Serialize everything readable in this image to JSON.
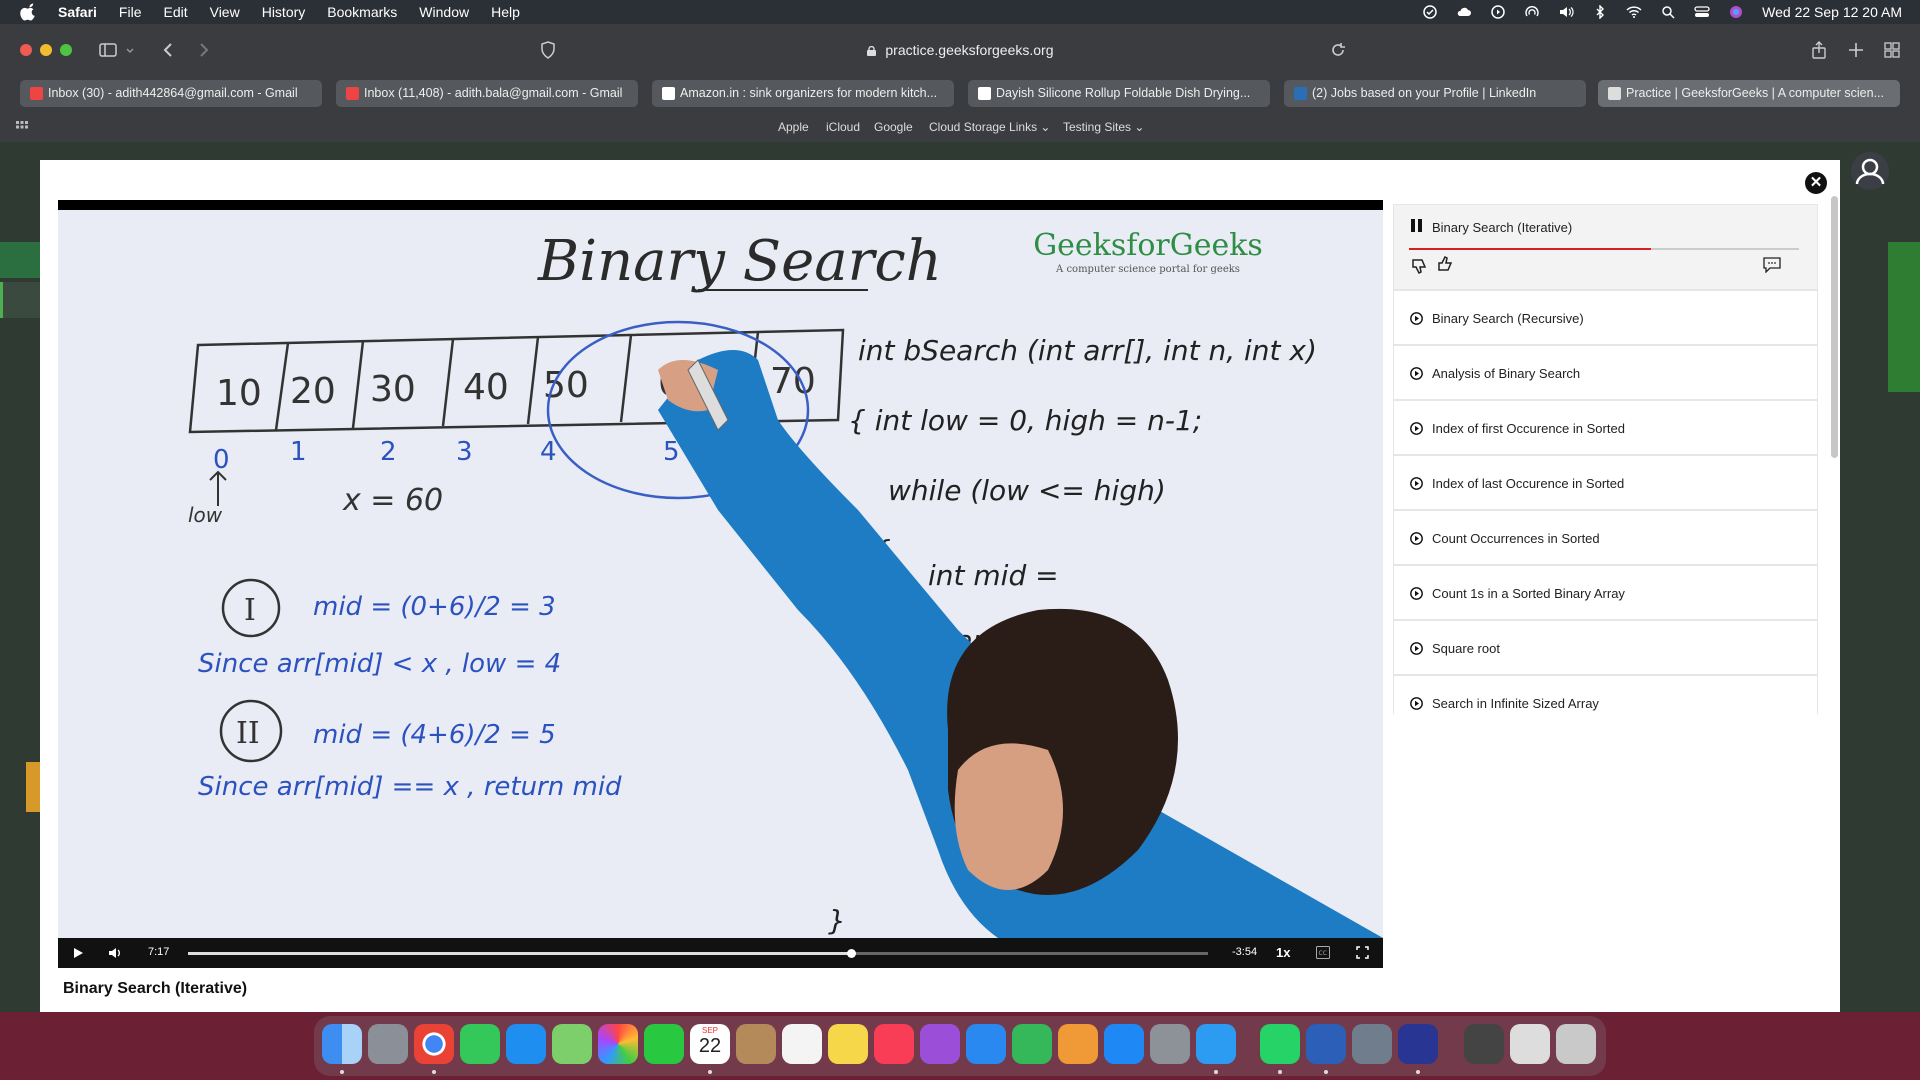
{
  "menubar": {
    "app_name": "Safari",
    "menus": [
      "File",
      "Edit",
      "View",
      "History",
      "Bookmarks",
      "Window",
      "Help"
    ],
    "clock": "Wed 22 Sep  12 20 AM"
  },
  "browser": {
    "url": "practice.geeksforgeeks.org",
    "tabs": [
      {
        "label": "Inbox (30) - adith442864@gmail.com - Gmail",
        "icon": "gmail-icon"
      },
      {
        "label": "Inbox (11,408) - adith.bala@gmail.com - Gmail",
        "icon": "gmail-icon"
      },
      {
        "label": "Amazon.in : sink organizers for modern kitch...",
        "icon": "amazon-icon"
      },
      {
        "label": "Dayish Silicone Rollup Foldable Dish Drying...",
        "icon": "amazon-icon"
      },
      {
        "label": "(2) Jobs based on your Profile | LinkedIn",
        "icon": "linkedin-icon"
      },
      {
        "label": "Practice | GeeksforGeeks | A computer scien...",
        "icon": "gfg-icon"
      }
    ],
    "favorites": [
      "Apple",
      "iCloud",
      "Google",
      "Cloud Storage Links",
      "Testing Sites"
    ]
  },
  "video": {
    "elapsed": "7:17",
    "remaining": "-3:54",
    "speed": "1x",
    "progress": 0.65,
    "watermark": "GeeksforGeeks",
    "watermark_tagline": "A computer science portal for geeks",
    "title": "Binary Search (Iterative)"
  },
  "whiteboard": {
    "heading": "Binary Search",
    "array": [
      "10",
      "20",
      "30",
      "40",
      "50",
      "60",
      "70"
    ],
    "indices": [
      "0",
      "1",
      "2",
      "3",
      "4",
      "5"
    ],
    "low_label": "low",
    "x_eq": "x = 60",
    "step1_num": "I",
    "step1_mid": "mid = (0+6)/2 = 3",
    "step1_since": "Since  arr[mid] < x ,  low = 4",
    "step2_num": "II",
    "step2_mid": "mid = (4+6)/2 = 5",
    "step2_since": "Since  arr[mid] == x ,  return mid",
    "code1": "int bSearch (int arr[], int n, int x)",
    "code2": "{   int low = 0,  high = n-1;",
    "code3": "while (low <= high)",
    "code4": "{",
    "code5": "int mid =",
    "code6": "if (arr[",
    "code7": "}"
  },
  "playlist": {
    "current": "Binary Search (Iterative)",
    "current_progress": 0.62,
    "items": [
      "Binary Search (Recursive)",
      "Analysis of Binary Search",
      "Index of first Occurence in Sorted",
      "Index of last Occurence in Sorted",
      "Count Occurrences in Sorted",
      "Count 1s in a Sorted Binary Array",
      "Square root",
      "Search in Infinite Sized Array"
    ]
  },
  "dock": {
    "calendar_month": "SEP",
    "calendar_day": "22"
  }
}
